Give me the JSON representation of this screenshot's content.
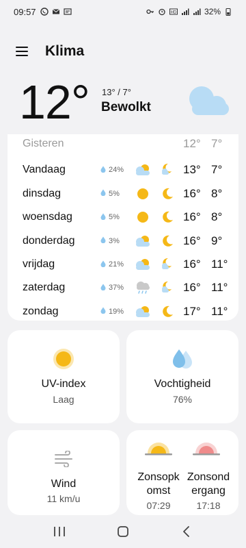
{
  "status": {
    "time": "09:57",
    "battery": "32%",
    "left_icons": [
      "whatsapp-icon",
      "mail-icon",
      "notification-icon"
    ],
    "right_icons": [
      "key-icon",
      "alarm-icon",
      "hd-icon",
      "signal-icon",
      "volte-icon",
      "wifi-icon",
      "battery-icon"
    ]
  },
  "app": {
    "title": "Klima"
  },
  "current": {
    "temperature": "12°",
    "range": "13° / 7°",
    "condition": "Bewolkt",
    "icon": "cloud-icon"
  },
  "forecast": [
    {
      "day": "Gisteren",
      "precip": "",
      "day_icon": "",
      "night_icon": "",
      "hi": "12°",
      "lo": "7°"
    },
    {
      "day": "Vandaag",
      "precip": "24%",
      "day_icon": "partly-cloudy-icon",
      "night_icon": "moon-cloud-icon",
      "hi": "13°",
      "lo": "7°"
    },
    {
      "day": "dinsdag",
      "precip": "5%",
      "day_icon": "sun-icon",
      "night_icon": "moon-icon",
      "hi": "16°",
      "lo": "8°"
    },
    {
      "day": "woensdag",
      "precip": "5%",
      "day_icon": "sun-icon",
      "night_icon": "moon-icon",
      "hi": "16°",
      "lo": "8°"
    },
    {
      "day": "donderdag",
      "precip": "3%",
      "day_icon": "partly-cloudy-icon",
      "night_icon": "moon-icon",
      "hi": "16°",
      "lo": "9°"
    },
    {
      "day": "vrijdag",
      "precip": "21%",
      "day_icon": "partly-cloudy-icon",
      "night_icon": "moon-cloud-icon",
      "hi": "16°",
      "lo": "11°"
    },
    {
      "day": "zaterdag",
      "precip": "37%",
      "day_icon": "rain-icon",
      "night_icon": "moon-cloud-icon",
      "hi": "16°",
      "lo": "11°"
    },
    {
      "day": "zondag",
      "precip": "19%",
      "day_icon": "partly-cloudy-icon",
      "night_icon": "moon-icon",
      "hi": "17°",
      "lo": "11°"
    }
  ],
  "tiles": {
    "uv": {
      "title": "UV-index",
      "value": "Laag",
      "icon": "uv-sun-icon"
    },
    "humidity": {
      "title": "Vochtigheid",
      "value": "76%",
      "icon": "droplets-icon"
    },
    "wind": {
      "title": "Wind",
      "value": "11 km/u",
      "icon": "wind-icon"
    },
    "sunrise": {
      "title_line1": "Zonsopk",
      "title_line2": "omst",
      "value": "07:29",
      "icon": "sunrise-icon"
    },
    "sunset": {
      "title_line1": "Zonsond",
      "title_line2": "ergang",
      "value": "17:18",
      "icon": "sunset-icon"
    }
  },
  "nav": {
    "icons": [
      "recent-apps-icon",
      "home-icon",
      "back-icon"
    ]
  },
  "colors": {
    "sun": "#f5b817",
    "cloud": "#b8dcf5",
    "drop": "#8cc6ee",
    "sunset": "#ef8b8b",
    "background": "#f2f2f4"
  }
}
